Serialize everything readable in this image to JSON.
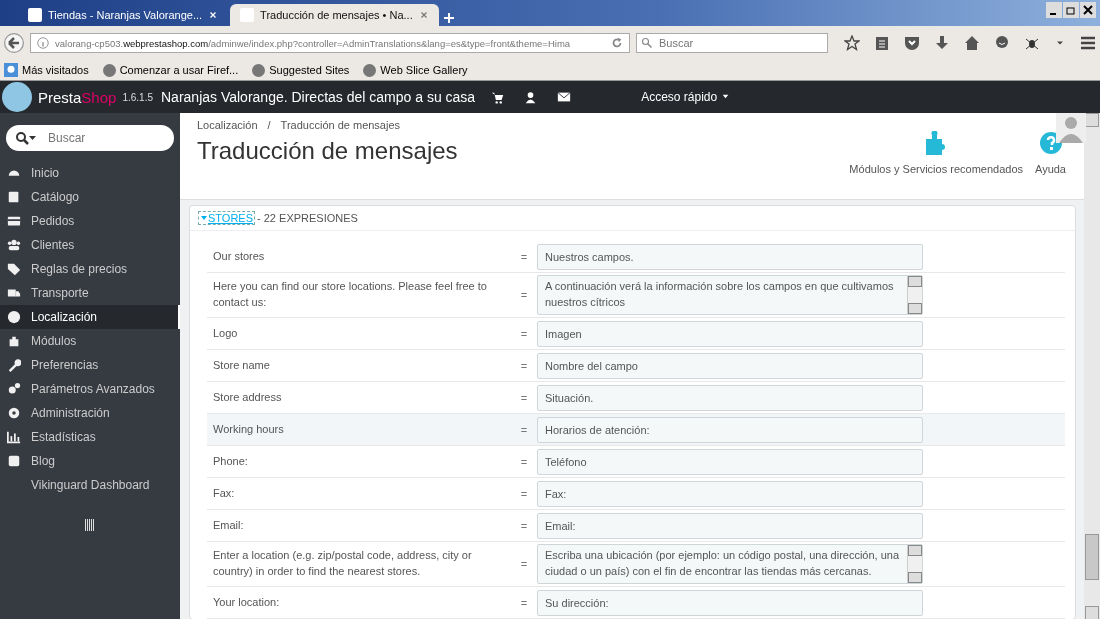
{
  "browser": {
    "tabs": [
      {
        "title": "Tiendas - Naranjas Valorange...",
        "selected": false
      },
      {
        "title": "Traducción de mensajes • Na...",
        "selected": true
      }
    ],
    "url": {
      "host_prefix": "valorang-cp503.",
      "host": "webprestashop.com",
      "path": "/adminwe/index.php?controller=AdminTranslations&lang=es&type=front&theme=Hima"
    },
    "search": {
      "placeholder": "Buscar"
    },
    "bookmarks": [
      "Más visitados",
      "Comenzar a usar Firef...",
      "Suggested Sites",
      "Web Slice Gallery"
    ]
  },
  "header": {
    "brand_a": "Presta",
    "brand_b": "Shop",
    "version": "1.6.1.5",
    "shop_name": "Naranjas Valorange. Directas del campo a su casa",
    "quick_access": "Acceso rápido"
  },
  "sidebar": {
    "search": {
      "placeholder": "Buscar"
    },
    "items": [
      {
        "label": "Inicio",
        "selected": false
      },
      {
        "label": "Catálogo",
        "selected": false
      },
      {
        "label": "Pedidos",
        "selected": false
      },
      {
        "label": "Clientes",
        "selected": false
      },
      {
        "label": "Reglas de precios",
        "selected": false
      },
      {
        "label": "Transporte",
        "selected": false
      },
      {
        "label": "Localización",
        "selected": true
      },
      {
        "label": "Módulos",
        "selected": false
      },
      {
        "label": "Preferencias",
        "selected": false
      },
      {
        "label": "Parámetros Avanzados",
        "selected": false
      },
      {
        "label": "Administración",
        "selected": false
      },
      {
        "label": "Estadísticas",
        "selected": false
      },
      {
        "label": "Blog",
        "selected": false
      },
      {
        "label": "Vikinguard Dashboard",
        "selected": false
      }
    ]
  },
  "page": {
    "breadcrumb": [
      "Localización",
      "Traducción de mensajes"
    ],
    "breadcrumb_separator": "/",
    "title": "Traducción de mensajes",
    "toolbar": [
      {
        "label": "Módulos y Servicios recomendados",
        "kind": "modules"
      },
      {
        "label": "Ayuda",
        "kind": "help"
      }
    ]
  },
  "panel": {
    "section": "STORES",
    "count": "- 22 EXPRESIONES",
    "rows": [
      {
        "source": "Our stores",
        "eq": "=",
        "translation": "Nuestros campos.",
        "kind": "input",
        "highlighted": false
      },
      {
        "source": "Here you can find our store locations. Please feel free to contact us:",
        "eq": "=",
        "translation": "A continuación verá la información sobre los campos en que cultivamos nuestros cítricos",
        "kind": "textarea",
        "highlighted": false
      },
      {
        "source": "Logo",
        "eq": "=",
        "translation": "Imagen",
        "kind": "input",
        "highlighted": false
      },
      {
        "source": "Store name",
        "eq": "=",
        "translation": "Nombre del campo",
        "kind": "input",
        "highlighted": false
      },
      {
        "source": "Store address",
        "eq": "=",
        "translation": "Situación.",
        "kind": "input",
        "highlighted": false
      },
      {
        "source": "Working hours",
        "eq": "=",
        "translation": "Horarios de atención:",
        "kind": "input",
        "highlighted": true
      },
      {
        "source": "Phone:",
        "eq": "=",
        "translation": "Teléfono",
        "kind": "input",
        "highlighted": false
      },
      {
        "source": "Fax:",
        "eq": "=",
        "translation": "Fax:",
        "kind": "input",
        "highlighted": false
      },
      {
        "source": "Email:",
        "eq": "=",
        "translation": "Email:",
        "kind": "input",
        "highlighted": false
      },
      {
        "source": "Enter a location (e.g. zip/postal code, address, city or country) in order to find the nearest stores.",
        "eq": "=",
        "translation": "Escriba una ubicación (por ejemplo: un código postal, una dirección, una ciudad o un país) con el fin de encontrar las tiendas más cercanas.",
        "kind": "textarea",
        "highlighted": false
      },
      {
        "source": "Your location:",
        "eq": "=",
        "translation": "Su dirección:",
        "kind": "input",
        "highlighted": false
      }
    ]
  }
}
